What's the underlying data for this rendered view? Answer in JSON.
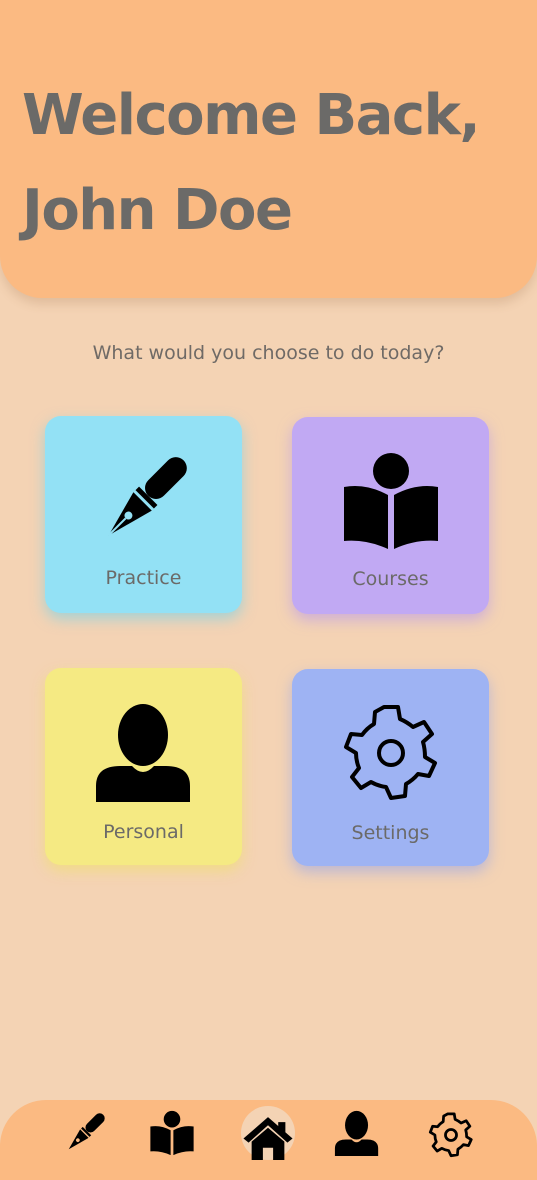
{
  "header": {
    "welcome_line1": "Welcome Back,",
    "welcome_line2": "John Doe"
  },
  "prompt": "What would you choose to do today?",
  "tiles": [
    {
      "label": "Practice",
      "icon": "pen-icon",
      "color": "#93e1f5"
    },
    {
      "label": "Courses",
      "icon": "book-reader-icon",
      "color": "#c1a9f3"
    },
    {
      "label": "Personal",
      "icon": "user-icon",
      "color": "#f5ea83"
    },
    {
      "label": "Settings",
      "icon": "gear-icon",
      "color": "#9eb3f3"
    }
  ],
  "nav": {
    "items": [
      {
        "icon": "pen-icon",
        "active": false
      },
      {
        "icon": "book-reader-icon",
        "active": false
      },
      {
        "icon": "home-icon",
        "active": true
      },
      {
        "icon": "user-icon",
        "active": false
      },
      {
        "icon": "gear-icon",
        "active": false
      }
    ]
  },
  "colors": {
    "background": "#f4d3b4",
    "header": "#fbba82",
    "text": "#6b6a68"
  }
}
